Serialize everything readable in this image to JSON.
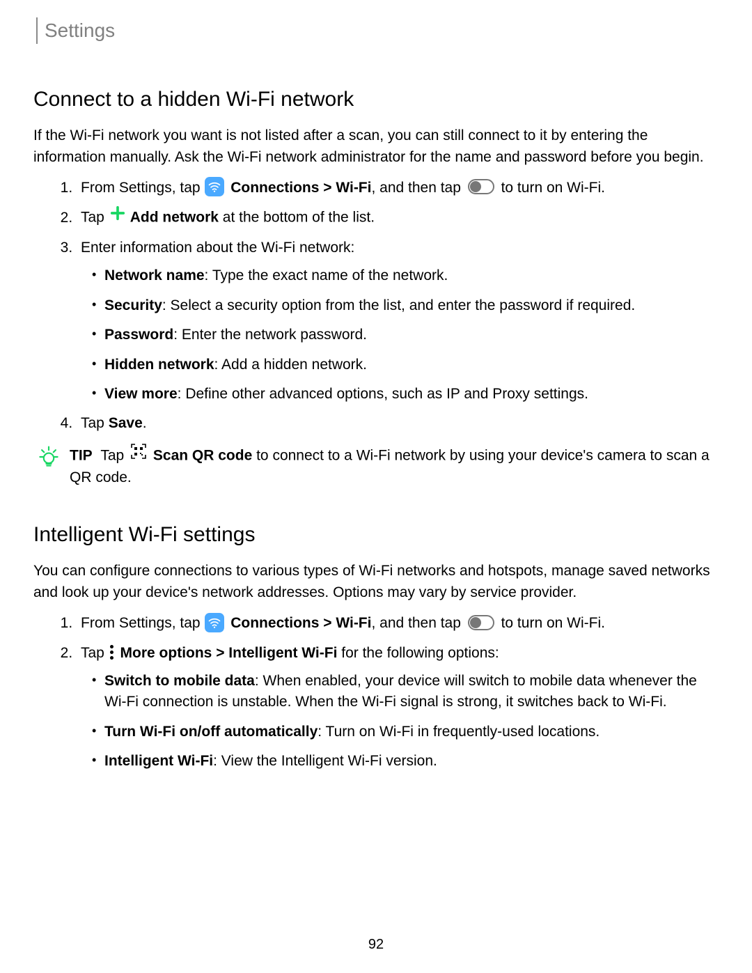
{
  "header": "Settings",
  "page_number": "92",
  "s1": {
    "title": "Connect to a hidden Wi-Fi network",
    "intro": "If the Wi-Fi network you want is not listed after a scan, you can still connect to it by entering the information manually. Ask the Wi-Fi network administrator for the name and password before you begin.",
    "step1_a": "From Settings, tap ",
    "step1_b": " Connections > Wi-Fi",
    "step1_c": ", and then tap ",
    "step1_d": " to turn on Wi-Fi.",
    "step2_a": "Tap ",
    "step2_b": " Add network",
    "step2_c": " at the bottom of the list.",
    "step3": "Enter information about the Wi-Fi network:",
    "b_net_name": "Network name",
    "b_net_name_t": ": Type the exact name of the network.",
    "b_sec": "Security",
    "b_sec_t": ": Select a security option from the list, and enter the password if required.",
    "b_pass": "Password",
    "b_pass_t": ": Enter the network password.",
    "b_hidden": "Hidden network",
    "b_hidden_t": ": Add a hidden network.",
    "b_view": "View more",
    "b_view_t": ": Define other advanced options, such as IP and Proxy settings.",
    "step4_a": "Tap ",
    "step4_b": "Save",
    "step4_c": ".",
    "tip_label": "TIP",
    "tip_a": "Tap ",
    "tip_b": " Scan QR code",
    "tip_c": " to connect to a Wi-Fi network by using your device's camera to scan a QR code."
  },
  "s2": {
    "title": "Intelligent Wi-Fi settings",
    "intro": "You can configure connections to various types of Wi-Fi networks and hotspots, manage saved networks and look up your device's network addresses. Options may vary by service provider.",
    "step1_a": "From Settings, tap ",
    "step1_b": " Connections > Wi-Fi",
    "step1_c": ", and then tap ",
    "step1_d": " to turn on Wi-Fi.",
    "step2_a": "Tap ",
    "step2_b": " More options > Intelligent Wi-Fi",
    "step2_c": " for the following options:",
    "b_switch": "Switch to mobile data",
    "b_switch_t": ": When enabled, your device will switch to mobile data whenever the Wi-Fi connection is unstable. When the Wi-Fi signal is strong, it switches back to Wi-Fi.",
    "b_auto": "Turn Wi-Fi on/off automatically",
    "b_auto_t": ": Turn on Wi-Fi in frequently-used locations.",
    "b_iwifi": "Intelligent Wi-Fi",
    "b_iwifi_t": ": View the Intelligent Wi-Fi version."
  }
}
